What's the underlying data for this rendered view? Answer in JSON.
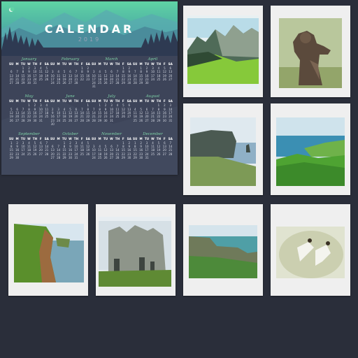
{
  "calendar": {
    "title": "CALENDAR",
    "year": "2019",
    "weekdays": [
      "SU",
      "M",
      "TU",
      "W",
      "TH",
      "F",
      "SA"
    ],
    "months": [
      {
        "name": "January",
        "offset": 2,
        "days": 31
      },
      {
        "name": "February",
        "offset": 5,
        "days": 28
      },
      {
        "name": "March",
        "offset": 5,
        "days": 31
      },
      {
        "name": "April",
        "offset": 1,
        "days": 30
      },
      {
        "name": "May",
        "offset": 3,
        "days": 31
      },
      {
        "name": "June",
        "offset": 6,
        "days": 30
      },
      {
        "name": "July",
        "offset": 1,
        "days": 31
      },
      {
        "name": "August",
        "offset": 4,
        "days": 31
      },
      {
        "name": "September",
        "offset": 0,
        "days": 30
      },
      {
        "name": "October",
        "offset": 2,
        "days": 31
      },
      {
        "name": "November",
        "offset": 5,
        "days": 30
      },
      {
        "name": "December",
        "offset": 0,
        "days": 31
      }
    ]
  },
  "pages": [
    {
      "name": "mountain-valley-photo"
    },
    {
      "name": "bear-photo"
    },
    {
      "name": "sea-cliff-photo"
    },
    {
      "name": "green-coast-photo"
    },
    {
      "name": "cliff-river-photo"
    },
    {
      "name": "castle-ruin-photo"
    },
    {
      "name": "rocky-coast-photo"
    },
    {
      "name": "dancers-photo"
    }
  ],
  "colors": {
    "background": "#2a2e3a",
    "cover": "#3d4459",
    "accent": "#7fd5a8",
    "card": "#efefef"
  }
}
